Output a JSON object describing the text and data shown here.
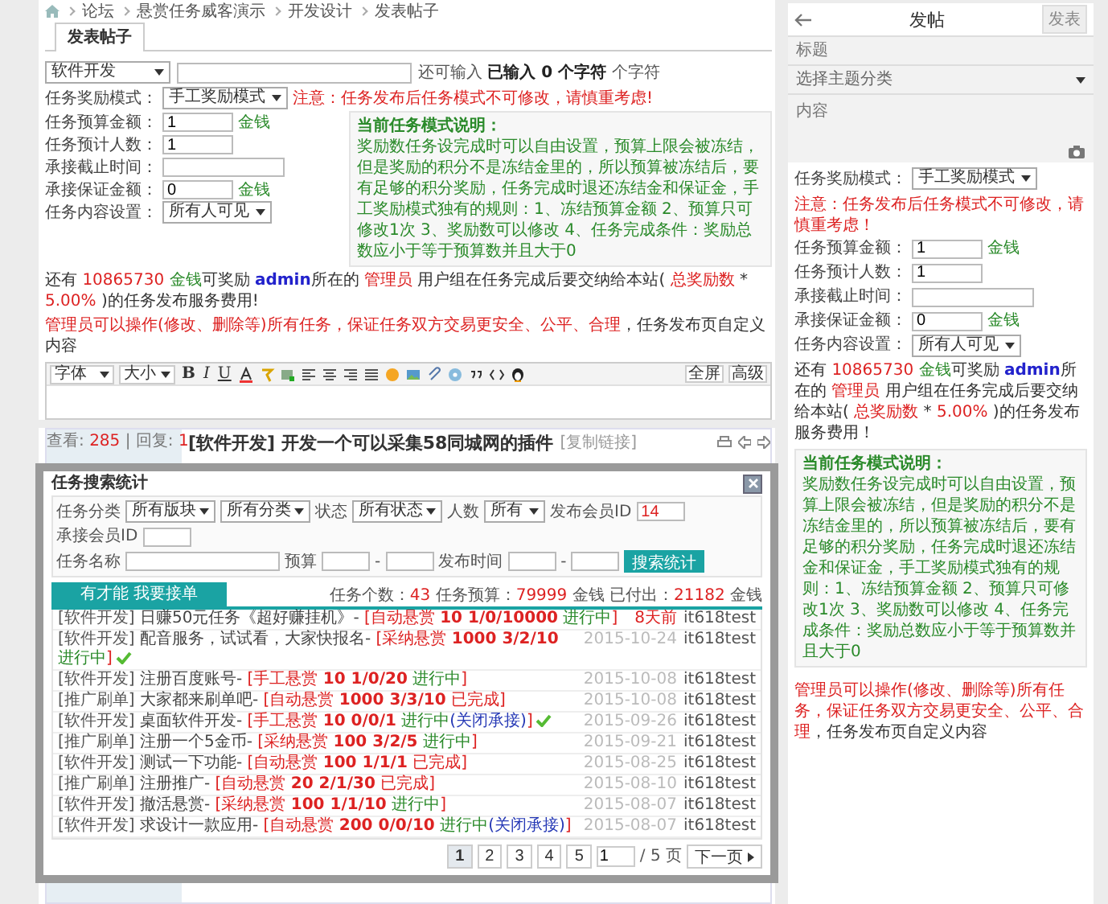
{
  "breadcrumb": [
    "论坛",
    "悬赏任务威客演示",
    "开发设计",
    "发表帖子"
  ],
  "tabs": [
    {
      "label": "发表帖子",
      "selected": true
    }
  ],
  "topic_row": {
    "category": "软件开发",
    "counter": [
      {
        "kind": "plain",
        "text": "还可输入 "
      },
      {
        "kind": "strong",
        "text": "已输入 0 个字符"
      },
      {
        "kind": "plain",
        "text": " 个字符"
      }
    ]
  },
  "fields": [
    {
      "label": "任务奖励模式：",
      "kind": "select",
      "value": "手工奖励模式",
      "note": "注意：任务发布后任务模式不可修改，请慎重考虑!"
    },
    {
      "label": "任务预算金额：",
      "kind": "input",
      "value": "1",
      "unit": "金钱"
    },
    {
      "label": "任务预计人数：",
      "kind": "input",
      "value": "1"
    },
    {
      "label": "承接截止时间：",
      "kind": "input"
    },
    {
      "label": "承接保证金额：",
      "kind": "input",
      "value": "0",
      "unit": "金钱"
    },
    {
      "label": "任务内容设置：",
      "kind": "select",
      "value": "所有人可见"
    }
  ],
  "mode_help": {
    "title": "当前任务模式说明：",
    "text": "奖励数任务设完成时可以自由设置，预算上限会被冻结，但是奖励的积分不是冻结金里的，所以预算被冻结后，要有足够的积分奖励，任务完成时退还冻结金和保证金，手工奖励模式独有的规则：1、冻结预算金额 2、预算只可修改1次 3、奖励数可以修改 4、任务完成条件：奖励总数应小于等于预算数并且大于0"
  },
  "fee_note": [
    {
      "kind": "plain",
      "text": "还有 "
    },
    {
      "kind": "amount",
      "text": "10865730"
    },
    {
      "kind": "unit",
      "text": " 金钱"
    },
    {
      "kind": "plain",
      "text": "可奖励 "
    },
    {
      "kind": "user",
      "text": "admin"
    },
    {
      "kind": "plain",
      "text": "所在的 "
    },
    {
      "kind": "amount",
      "text": "管理员"
    },
    {
      "kind": "plain",
      "text": " 用户组在任务完成后要交纳给本站( "
    },
    {
      "kind": "amount",
      "text": "总奖励数"
    },
    {
      "kind": "plain",
      "text": " * "
    },
    {
      "kind": "amount",
      "text": "5.00%"
    },
    {
      "kind": "plain",
      "text": " )的任务发布服务费用!"
    }
  ],
  "admin_note": [
    {
      "kind": "amount",
      "text": "管理员可以操作(修改、删除等)所有任务，保证任务双方交易更安全、公平、合理"
    },
    {
      "kind": "plain",
      "text": "，任务发布页自定义内容"
    }
  ],
  "editor": {
    "font": "字体",
    "size": "大小",
    "format_buttons": [
      "B",
      "I",
      "U"
    ],
    "actions": [
      "全屏",
      "高级"
    ]
  },
  "post": {
    "stats": [
      {
        "kind": "plain",
        "text": "查看: "
      },
      {
        "kind": "amount",
        "text": "285"
      },
      {
        "kind": "plain",
        "text": " | 回复: "
      },
      {
        "kind": "amount",
        "text": "1"
      }
    ],
    "title": "[软件开发] 开发一个可以采集58同城网的插件",
    "copy_link": "[复制链接]"
  },
  "side_panel": {
    "title": "发帖",
    "publish": "发表",
    "title_placeholder": "标题",
    "category_placeholder": "选择主题分类",
    "content_placeholder": "内容",
    "fields": [
      {
        "label": "任务奖励模式：",
        "kind": "select",
        "value": "手工奖励模式",
        "note": "注意：任务发布后任务模式不可修改，请慎重考虑！"
      },
      {
        "label": "任务预算金额：",
        "kind": "input",
        "value": "1",
        "unit": "金钱"
      },
      {
        "label": "任务预计人数：",
        "kind": "input",
        "value": "1"
      },
      {
        "label": "承接截止时间：",
        "kind": "input"
      },
      {
        "label": "承接保证金额：",
        "kind": "input",
        "value": "0",
        "unit": "金钱"
      },
      {
        "label": "任务内容设置：",
        "kind": "select",
        "value": "所有人可见"
      }
    ],
    "fee_note": [
      {
        "kind": "plain",
        "text": "还有 "
      },
      {
        "kind": "amount",
        "text": "10865730"
      },
      {
        "kind": "unit",
        "text": " 金钱"
      },
      {
        "kind": "plain",
        "text": "可奖励 "
      },
      {
        "kind": "user",
        "text": "admin"
      },
      {
        "kind": "plain",
        "text": "所在的 "
      },
      {
        "kind": "amount",
        "text": "管理员"
      },
      {
        "kind": "plain",
        "text": " 用户组在任务完成后要交纳给本站( "
      },
      {
        "kind": "amount",
        "text": "总奖励数"
      },
      {
        "kind": "plain",
        "text": " * "
      },
      {
        "kind": "amount",
        "text": "5.00%"
      },
      {
        "kind": "plain",
        "text": " )的任务发布服务费用！"
      }
    ],
    "mode_help": {
      "title": "当前任务模式说明：",
      "text": "奖励数任务设完成时可以自由设置，预算上限会被冻结，但是奖励的积分不是冻结金里的，所以预算被冻结后，要有足够的积分奖励，任务完成时退还冻结金和保证金，手工奖励模式独有的规则：1、冻结预算金额 2、预算只可修改1次 3、奖励数可以修改 4、任务完成条件：奖励总数应小于等于预算数并且大于0"
    },
    "admin_note": [
      {
        "kind": "amount",
        "text": "管理员可以操作(修改、删除等)所有任务，保证任务双方交易更安全、公平、合理"
      },
      {
        "kind": "plain",
        "text": "，任务发布页自定义内容"
      }
    ]
  },
  "modal": {
    "title": "任务搜索统计",
    "filter_rows": [
      {
        "items": [
          {
            "kind": "label",
            "text": "任务分类"
          },
          {
            "kind": "select",
            "text": "所有版块"
          },
          {
            "kind": "select",
            "text": "所有分类"
          },
          {
            "kind": "label",
            "text": "状态"
          },
          {
            "kind": "select",
            "text": "所有状态"
          },
          {
            "kind": "label",
            "text": "人数"
          },
          {
            "kind": "select",
            "text": "所有"
          },
          {
            "kind": "label",
            "text": "发布会员ID"
          },
          {
            "kind": "input",
            "text": "14"
          },
          {
            "kind": "label",
            "text": "承接会员ID"
          },
          {
            "kind": "input"
          }
        ]
      },
      {
        "items": [
          {
            "kind": "label",
            "text": "任务名称"
          },
          {
            "kind": "wide_input"
          },
          {
            "kind": "label",
            "text": "预算"
          },
          {
            "kind": "input"
          },
          {
            "kind": "label",
            "text": "-"
          },
          {
            "kind": "input"
          },
          {
            "kind": "label",
            "text": "发布时间"
          },
          {
            "kind": "input"
          },
          {
            "kind": "label",
            "text": "-"
          },
          {
            "kind": "input"
          },
          {
            "kind": "button",
            "text": "搜索统计"
          }
        ]
      }
    ],
    "tab": "有才能 我要接单",
    "summary": [
      {
        "kind": "plain",
        "text": "任务个数："
      },
      {
        "kind": "amount",
        "text": "43"
      },
      {
        "kind": "plain",
        "text": " 任务预算："
      },
      {
        "kind": "amount",
        "text": "79999"
      },
      {
        "kind": "plain",
        "text": " 金钱 已付出："
      },
      {
        "kind": "amount",
        "text": "21182"
      },
      {
        "kind": "plain",
        "text": " 金钱"
      }
    ],
    "rows": [
      {
        "segments": [
          {
            "kind": "category",
            "text": "[软件开发] "
          },
          {
            "kind": "plain",
            "text": "日赚50元任务《超好赚挂机》- "
          },
          {
            "kind": "reward",
            "text": "[自动悬赏 "
          },
          {
            "kind": "value",
            "text": "10 1/0/10000"
          },
          {
            "kind": "active",
            "text": " 进行中"
          },
          {
            "kind": "reward",
            "text": "]"
          }
        ],
        "checked": false,
        "time": "8天前",
        "recent": true,
        "user": "it618test"
      },
      {
        "segments": [
          {
            "kind": "category",
            "text": "[软件开发] "
          },
          {
            "kind": "plain",
            "text": "配音服务，试试看，大家快报名- "
          },
          {
            "kind": "reward",
            "text": "[采纳悬赏 "
          },
          {
            "kind": "value",
            "text": "1000 3/2/10"
          },
          {
            "kind": "active",
            "text": " 进行中"
          },
          {
            "kind": "reward",
            "text": "]"
          }
        ],
        "checked": true,
        "time": "2015-10-24",
        "recent": false,
        "user": "it618test"
      },
      {
        "segments": [
          {
            "kind": "category",
            "text": "[软件开发] "
          },
          {
            "kind": "plain",
            "text": "注册百度账号- "
          },
          {
            "kind": "reward",
            "text": "[手工悬赏 "
          },
          {
            "kind": "value",
            "text": "10 1/0/20"
          },
          {
            "kind": "active",
            "text": " 进行中"
          },
          {
            "kind": "reward",
            "text": "]"
          }
        ],
        "checked": false,
        "time": "2015-10-08",
        "recent": false,
        "user": "it618test"
      },
      {
        "segments": [
          {
            "kind": "category",
            "text": "[推广刷单] "
          },
          {
            "kind": "plain",
            "text": "大家都来刷单吧- "
          },
          {
            "kind": "reward",
            "text": "[自动悬赏 "
          },
          {
            "kind": "value",
            "text": "1000 3/3/10"
          },
          {
            "kind": "done",
            "text": " 已完成"
          },
          {
            "kind": "reward",
            "text": "]"
          }
        ],
        "checked": false,
        "time": "2015-10-08",
        "recent": false,
        "user": "it618test"
      },
      {
        "segments": [
          {
            "kind": "category",
            "text": "[软件开发] "
          },
          {
            "kind": "plain",
            "text": "桌面软件开发- "
          },
          {
            "kind": "reward",
            "text": "[手工悬赏 "
          },
          {
            "kind": "value",
            "text": "10 0/0/1"
          },
          {
            "kind": "active",
            "text": " 进行中"
          },
          {
            "kind": "closed",
            "text": "(关闭承接)"
          },
          {
            "kind": "reward",
            "text": "]"
          }
        ],
        "checked": true,
        "time": "2015-09-26",
        "recent": false,
        "user": "it618test"
      },
      {
        "segments": [
          {
            "kind": "category",
            "text": "[推广刷单] "
          },
          {
            "kind": "plain",
            "text": "注册一个5金币- "
          },
          {
            "kind": "reward",
            "text": "[采纳悬赏 "
          },
          {
            "kind": "value",
            "text": "100 3/2/5"
          },
          {
            "kind": "active",
            "text": " 进行中"
          },
          {
            "kind": "reward",
            "text": "]"
          }
        ],
        "checked": false,
        "time": "2015-09-21",
        "recent": false,
        "user": "it618test"
      },
      {
        "segments": [
          {
            "kind": "category",
            "text": "[软件开发] "
          },
          {
            "kind": "plain",
            "text": "测试一下功能- "
          },
          {
            "kind": "reward",
            "text": "[自动悬赏 "
          },
          {
            "kind": "value",
            "text": "100 1/1/1"
          },
          {
            "kind": "done",
            "text": " 已完成"
          },
          {
            "kind": "reward",
            "text": "]"
          }
        ],
        "checked": false,
        "time": "2015-08-25",
        "recent": false,
        "user": "it618test"
      },
      {
        "segments": [
          {
            "kind": "category",
            "text": "[推广刷单] "
          },
          {
            "kind": "plain",
            "text": "注册推广- "
          },
          {
            "kind": "reward",
            "text": "[自动悬赏 "
          },
          {
            "kind": "value",
            "text": "20 2/1/30"
          },
          {
            "kind": "done",
            "text": " 已完成"
          },
          {
            "kind": "reward",
            "text": "]"
          }
        ],
        "checked": false,
        "time": "2015-08-10",
        "recent": false,
        "user": "it618test"
      },
      {
        "segments": [
          {
            "kind": "category",
            "text": "[软件开发] "
          },
          {
            "kind": "plain",
            "text": "撤活悬赏- "
          },
          {
            "kind": "reward",
            "text": "[采纳悬赏 "
          },
          {
            "kind": "value",
            "text": "100 1/1/10"
          },
          {
            "kind": "active",
            "text": " 进行中"
          },
          {
            "kind": "reward",
            "text": "]"
          }
        ],
        "checked": false,
        "time": "2015-08-07",
        "recent": false,
        "user": "it618test"
      },
      {
        "segments": [
          {
            "kind": "category",
            "text": "[软件开发] "
          },
          {
            "kind": "plain",
            "text": "求设计一款应用- "
          },
          {
            "kind": "reward",
            "text": "[自动悬赏 "
          },
          {
            "kind": "value",
            "text": "200 0/0/10"
          },
          {
            "kind": "active",
            "text": " 进行中"
          },
          {
            "kind": "closed",
            "text": "(关闭承接)"
          },
          {
            "kind": "reward",
            "text": "]"
          }
        ],
        "checked": false,
        "time": "2015-08-07",
        "recent": false,
        "user": "it618test"
      }
    ],
    "pagination": {
      "pages": [
        {
          "label": "1",
          "selected": true
        },
        {
          "label": "2",
          "selected": false
        },
        {
          "label": "3",
          "selected": false
        },
        {
          "label": "4",
          "selected": false
        },
        {
          "label": "5",
          "selected": false
        }
      ],
      "page_input": "1",
      "total": "/ 5 页",
      "next": "下一页"
    }
  }
}
